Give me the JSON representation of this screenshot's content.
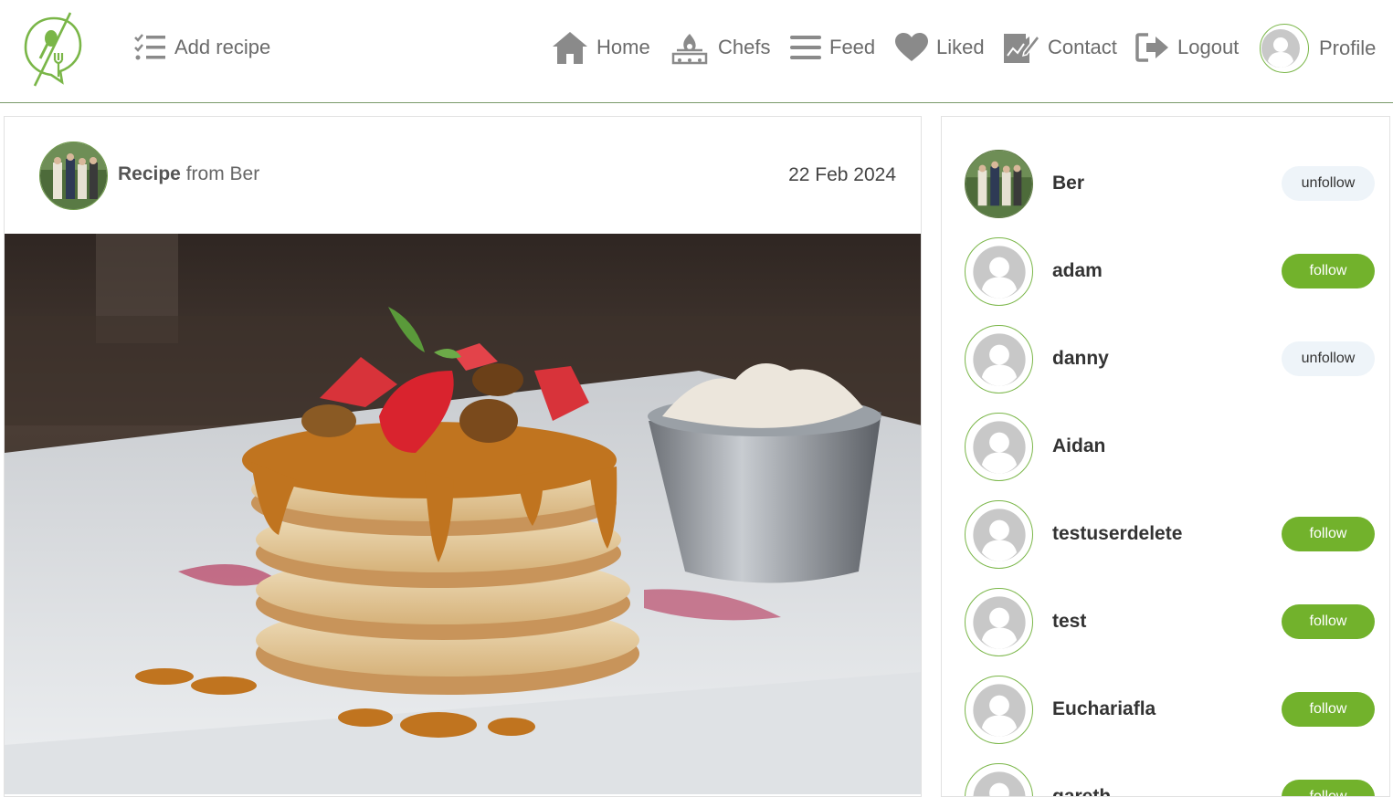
{
  "nav": {
    "add_recipe": "Add recipe",
    "home": "Home",
    "chefs": "Chefs",
    "feed": "Feed",
    "liked": "Liked",
    "contact": "Contact",
    "logout": "Logout",
    "profile": "Profile"
  },
  "post": {
    "title_bold": "Recipe",
    "title_rest": " from Ber",
    "date": "22 Feb 2024",
    "image_icon": "pancake-stack-photo"
  },
  "chefs": [
    {
      "name": "Ber",
      "action": "unfollow"
    },
    {
      "name": "adam",
      "action": "follow"
    },
    {
      "name": "danny",
      "action": "unfollow"
    },
    {
      "name": "Aidan",
      "action": ""
    },
    {
      "name": "testuserdelete",
      "action": "follow"
    },
    {
      "name": "test",
      "action": "follow"
    },
    {
      "name": "Euchariafla",
      "action": "follow"
    },
    {
      "name": "gareth",
      "action": "follow"
    }
  ],
  "colors": {
    "accent_green": "#72b22c",
    "unfollow_bg": "#eef4f9",
    "nav_icon_gray": "#8a8a8a"
  }
}
